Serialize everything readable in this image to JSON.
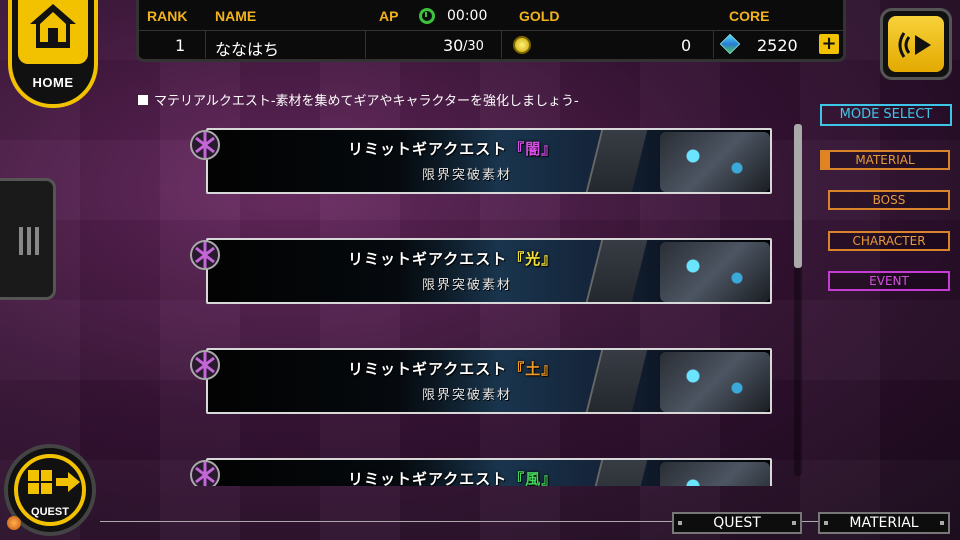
{
  "home": {
    "label": "HOME"
  },
  "status": {
    "headers": {
      "rank": "RANK",
      "name": "NAME",
      "ap": "AP",
      "gold": "GOLD",
      "core": "CORE"
    },
    "rank": "1",
    "name": "ななはち",
    "ap_timer": "00:00",
    "ap_current": "30",
    "ap_max": "/30",
    "gold": "0",
    "core": "2520",
    "core_add": "+"
  },
  "subtitle": "マテリアルクエスト-素材を集めてギアやキャラクターを強化しましょう-",
  "quests": [
    {
      "title": "リミットギアクエスト",
      "element": "『闇』",
      "element_color": "#d34fe6",
      "subtitle": "限界突破素材"
    },
    {
      "title": "リミットギアクエスト",
      "element": "『光』",
      "element_color": "#f3e23a",
      "subtitle": "限界突破素材"
    },
    {
      "title": "リミットギアクエスト",
      "element": "『土』",
      "element_color": "#f39a22",
      "subtitle": "限界突破素材"
    },
    {
      "title": "リミットギアクエスト",
      "element": "『風』",
      "element_color": "#45d25a",
      "subtitle": ""
    }
  ],
  "menu": {
    "mode_select": "MODE SELECT",
    "material": "MATERIAL",
    "boss": "BOSS",
    "character": "CHARACTER",
    "event": "EVENT"
  },
  "quest_badge": {
    "label": "QUEST"
  },
  "breadcrumb": {
    "quest": "QUEST",
    "material": "MATERIAL"
  },
  "colors": {
    "accent_yellow": "#f2c200",
    "header_gold": "#f2b21c",
    "mode_cyan": "#3ec6e8",
    "menu_orange": "#d9832a",
    "event_purple": "#c63ad6"
  }
}
